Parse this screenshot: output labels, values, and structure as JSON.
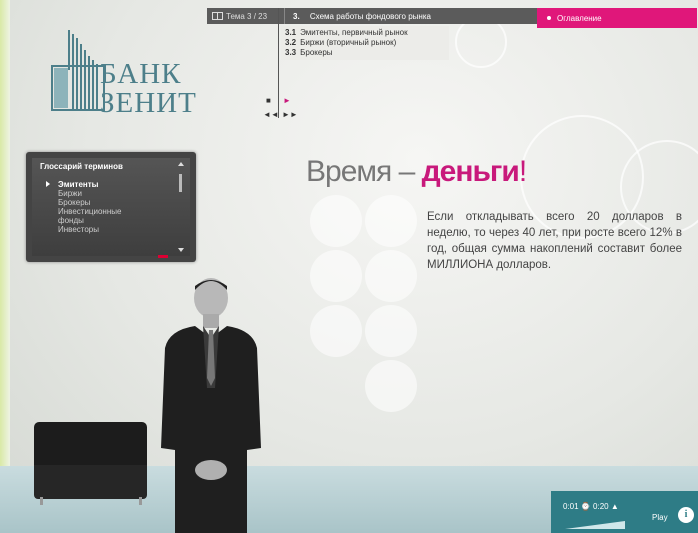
{
  "topbar": {
    "topic_counter": "Тема 3 / 23",
    "section_number": "3.",
    "section_title": "Схема работы фондового рынка",
    "toc_label": "Оглавление"
  },
  "subsections": [
    {
      "num": "3.1",
      "label": "Эмитенты, первичный рынок"
    },
    {
      "num": "3.2",
      "label": "Биржи (вторичный рынок)"
    },
    {
      "num": "3.3",
      "label": "Брокеры"
    }
  ],
  "nav": {
    "stop": "■",
    "next": "►",
    "rewind": "◄◄",
    "forward": "►►"
  },
  "logo": {
    "line1": "БАНК",
    "line2": "ЗЕНИТ"
  },
  "glossary": {
    "title": "Глоссарий терминов",
    "items": [
      "Эмитенты",
      "Биржи",
      "Брокеры",
      "Инвестиционные",
      "фонды",
      "Инвесторы"
    ]
  },
  "headline": {
    "part1": "Время – ",
    "part2": "деньги",
    "part3": "!"
  },
  "body_text": "Если откладывать всего 20 долларов в неделю, то через 40 лет, при росте всего 12% в год, общая сумма накоплений составит более МИЛЛИОНА долларов.",
  "player": {
    "elapsed": "0:01",
    "clock_icon": "clock-icon",
    "duration": "0:20",
    "play_label": "Play",
    "info_label": "i"
  },
  "colors": {
    "accent": "#c8197b",
    "toc": "#e0177a",
    "logo": "#4d7f8a",
    "player": "#2e7c86"
  }
}
